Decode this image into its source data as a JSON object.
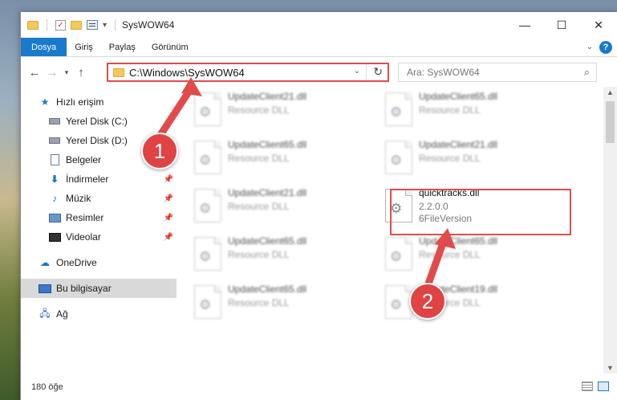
{
  "window": {
    "title": "SysWOW64",
    "minimize": "—",
    "maximize": "☐",
    "close": "✕"
  },
  "ribbon": {
    "tabs": [
      "Dosya",
      "Giriş",
      "Paylaş",
      "Görünüm"
    ],
    "help": "?"
  },
  "address": {
    "path": "C:\\Windows\\SysWOW64"
  },
  "search": {
    "placeholder": "Ara: SysWOW64"
  },
  "sidebar": {
    "items": [
      {
        "label": "Hızlı erişim",
        "icon": "star-icon"
      },
      {
        "label": "Yerel Disk (C:)",
        "icon": "drive-icon"
      },
      {
        "label": "Yerel Disk (D:)",
        "icon": "drive-icon"
      },
      {
        "label": "Belgeler",
        "icon": "document-icon"
      },
      {
        "label": "İndirmeler",
        "icon": "download-icon"
      },
      {
        "label": "Müzik",
        "icon": "music-icon"
      },
      {
        "label": "Resimler",
        "icon": "pictures-icon"
      },
      {
        "label": "Videolar",
        "icon": "video-icon"
      },
      {
        "label": "OneDrive",
        "icon": "cloud-icon"
      },
      {
        "label": "Bu bilgisayar",
        "icon": "computer-icon"
      },
      {
        "label": "Ağ",
        "icon": "network-icon"
      }
    ]
  },
  "files": [
    {
      "name": "UpdateClient21.dll",
      "type": "Resource DLL"
    },
    {
      "name": "UpdateClient65.dll",
      "type": "Resource DLL"
    },
    {
      "name": "UpdateClient65.dll",
      "type": "Resource DLL"
    },
    {
      "name": "UpdateClient21.dll",
      "type": "Resource DLL"
    },
    {
      "name": "UpdateClient21.dll",
      "type": "Resource DLL"
    },
    {
      "name": "UpdateClient65.dll",
      "type": "Resource DLL"
    },
    {
      "name": "UpdateClient65.dll",
      "type": "Resource DLL"
    },
    {
      "name": "UpdateClient19.dll",
      "type": "Resource DLL"
    },
    {
      "name": "UpdateClient65.dll",
      "type": "Resource DLL"
    }
  ],
  "highlighted_file": {
    "name": "quicktracks.dll",
    "version": "2.2.0.0",
    "description": "6FileVersion"
  },
  "status": {
    "count": "180 öğe"
  },
  "annotations": {
    "step1": "1",
    "step2": "2",
    "color": "#e24b4b"
  }
}
